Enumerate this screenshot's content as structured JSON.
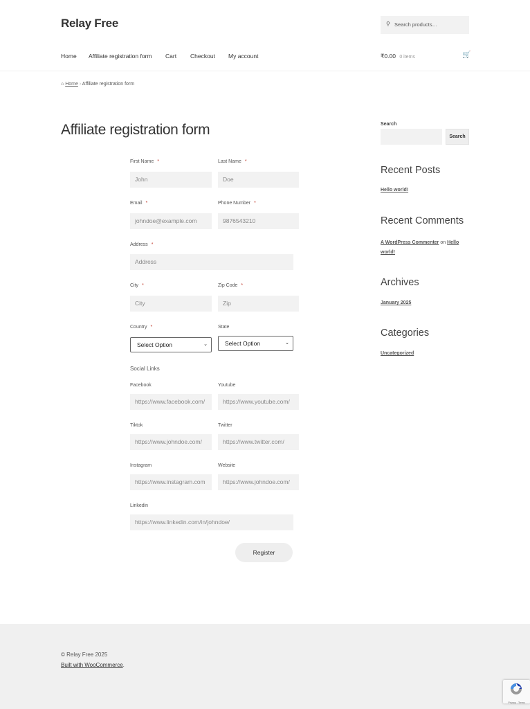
{
  "header": {
    "site_title": "Relay Free",
    "search_placeholder": "Search products…",
    "nav": [
      "Home",
      "Affiliate registration form",
      "Cart",
      "Checkout",
      "My account"
    ],
    "cart_total": "₹0.00",
    "cart_count": "0 items"
  },
  "breadcrumb": {
    "home": "Home",
    "separator": "›",
    "current": "Affiliate registration form"
  },
  "page": {
    "title": "Affiliate registration form"
  },
  "form": {
    "required_mark": "*",
    "first_name": {
      "label": "First Name",
      "value": "John"
    },
    "last_name": {
      "label": "Last Name",
      "value": "Doe"
    },
    "email": {
      "label": "Email",
      "value": "johndoe@example.com"
    },
    "phone": {
      "label": "Phone Number",
      "value": "9876543210"
    },
    "address": {
      "label": "Address",
      "placeholder": "Address"
    },
    "city": {
      "label": "City",
      "placeholder": "City"
    },
    "zip": {
      "label": "Zip Code",
      "placeholder": "Zip"
    },
    "country": {
      "label": "Country",
      "selected": "Select Option"
    },
    "state": {
      "label": "State",
      "selected": "Select Option"
    },
    "social_heading": "Social Links",
    "facebook": {
      "label": "Facebook",
      "value": "https://www.facebook.com/"
    },
    "youtube": {
      "label": "Youtube",
      "value": "https://www.youtube.com/"
    },
    "tiktok": {
      "label": "Tiktok",
      "value": "https://www.johndoe.com/"
    },
    "twitter": {
      "label": "Twitter",
      "value": "https://www.twitter.com/"
    },
    "instagram": {
      "label": "Instagram",
      "value": "https://www.instagram.com"
    },
    "website": {
      "label": "Website",
      "value": "https://www.johndoe.com/"
    },
    "linkedin": {
      "label": "Linkedin",
      "value": "https://www.linkedin.com/in/johndoe/"
    },
    "register": "Register"
  },
  "sidebar": {
    "search_label": "Search",
    "search_button": "Search",
    "recent_posts": "Recent Posts",
    "post": "Hello world!",
    "recent_comments": "Recent Comments",
    "commenter": "A WordPress Commenter",
    "on": "on",
    "comment_post": "Hello world!",
    "archives": "Archives",
    "archive": "January 2025",
    "categories": "Categories",
    "category": "Uncategorized"
  },
  "footer": {
    "copyright": "© Relay Free 2025",
    "built": "Built with WooCommerce",
    "period": "."
  },
  "recaptcha": {
    "text": "Privacy - Terms"
  }
}
